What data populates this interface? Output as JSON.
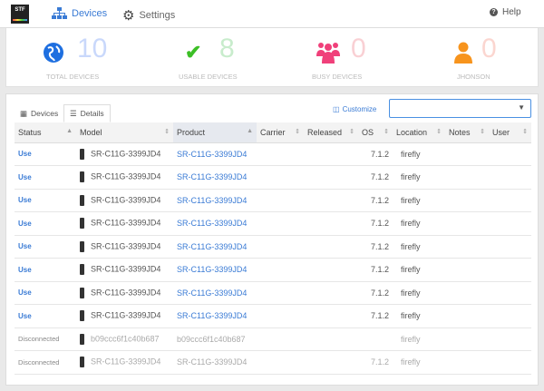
{
  "nav": {
    "logo": "STF",
    "devices": "Devices",
    "settings": "Settings",
    "help": "Help"
  },
  "stats": [
    {
      "value": "10",
      "label": "TOTAL DEVICES",
      "color": "#1e6fe0",
      "numcolor": "#c9d8fb"
    },
    {
      "value": "8",
      "label": "USABLE DEVICES",
      "color": "#3cbf26",
      "numcolor": "#c8eccc"
    },
    {
      "value": "0",
      "label": "BUSY DEVICES",
      "color": "#f0407a",
      "numcolor": "#f9d0d4"
    },
    {
      "value": "0",
      "label": "JHONSON",
      "color": "#f7941d",
      "numcolor": "#fbd6d0"
    }
  ],
  "tabs": {
    "devices": "Devices",
    "details": "Details",
    "customize": "Customize",
    "select_arrow": "▼"
  },
  "columns": [
    "Status",
    "Model",
    "Product",
    "Carrier",
    "Released",
    "OS",
    "Location",
    "Notes",
    "User"
  ],
  "rows": [
    {
      "status": "Use",
      "model": "SR-C11G-3399JD4",
      "product": "SR-C11G-3399JD4",
      "os": "7.1.2",
      "location": "firefly",
      "connected": true
    },
    {
      "status": "Use",
      "model": "SR-C11G-3399JD4",
      "product": "SR-C11G-3399JD4",
      "os": "7.1.2",
      "location": "firefly",
      "connected": true
    },
    {
      "status": "Use",
      "model": "SR-C11G-3399JD4",
      "product": "SR-C11G-3399JD4",
      "os": "7.1.2",
      "location": "firefly",
      "connected": true
    },
    {
      "status": "Use",
      "model": "SR-C11G-3399JD4",
      "product": "SR-C11G-3399JD4",
      "os": "7.1.2",
      "location": "firefly",
      "connected": true
    },
    {
      "status": "Use",
      "model": "SR-C11G-3399JD4",
      "product": "SR-C11G-3399JD4",
      "os": "7.1.2",
      "location": "firefly",
      "connected": true
    },
    {
      "status": "Use",
      "model": "SR-C11G-3399JD4",
      "product": "SR-C11G-3399JD4",
      "os": "7.1.2",
      "location": "firefly",
      "connected": true
    },
    {
      "status": "Use",
      "model": "SR-C11G-3399JD4",
      "product": "SR-C11G-3399JD4",
      "os": "7.1.2",
      "location": "firefly",
      "connected": true
    },
    {
      "status": "Use",
      "model": "SR-C11G-3399JD4",
      "product": "SR-C11G-3399JD4",
      "os": "7.1.2",
      "location": "firefly",
      "connected": true
    },
    {
      "status": "Disconnected",
      "model": "b09ccc6f1c40b687",
      "product": "b09ccc6f1c40b687",
      "os": "",
      "location": "firefly",
      "connected": false
    },
    {
      "status": "Disconnected",
      "model": "SR-C11G-3399JD4",
      "product": "SR-C11G-3399JD4",
      "os": "7.1.2",
      "location": "firefly",
      "connected": false
    }
  ]
}
